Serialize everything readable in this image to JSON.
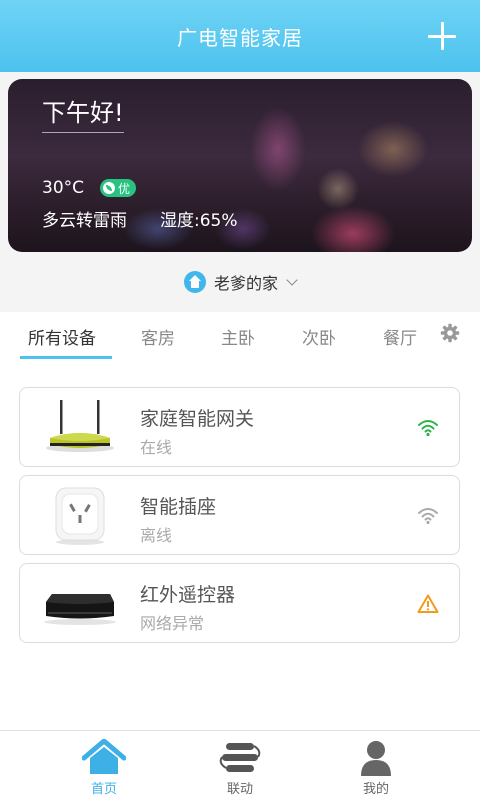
{
  "header": {
    "title": "广电智能家居"
  },
  "weather": {
    "greeting": "下午好!",
    "temperature": "30°C",
    "aqi": "优",
    "description": "多云转雷雨",
    "humidity": "湿度:65%"
  },
  "home": {
    "name": "老爹的家"
  },
  "tabs": [
    {
      "label": "所有设备",
      "active": true
    },
    {
      "label": "客房"
    },
    {
      "label": "主卧"
    },
    {
      "label": "次卧"
    },
    {
      "label": "餐厅"
    }
  ],
  "devices": [
    {
      "name": "家庭智能网关",
      "status": "在线",
      "indicator": "wifi-online-icon"
    },
    {
      "name": "智能插座",
      "status": "离线",
      "indicator": "wifi-offline-icon"
    },
    {
      "name": "红外遥控器",
      "status": "网络异常",
      "indicator": "warning-icon"
    }
  ],
  "bottom_nav": [
    {
      "label": "首页",
      "icon": "home-icon",
      "active": true
    },
    {
      "label": "联动",
      "icon": "linkage-icon"
    },
    {
      "label": "我的",
      "icon": "user-icon"
    }
  ],
  "colors": {
    "accent": "#4cc2ee",
    "online": "#2cb34a",
    "warning": "#f29a1c",
    "offline": "#aaaaaa"
  }
}
